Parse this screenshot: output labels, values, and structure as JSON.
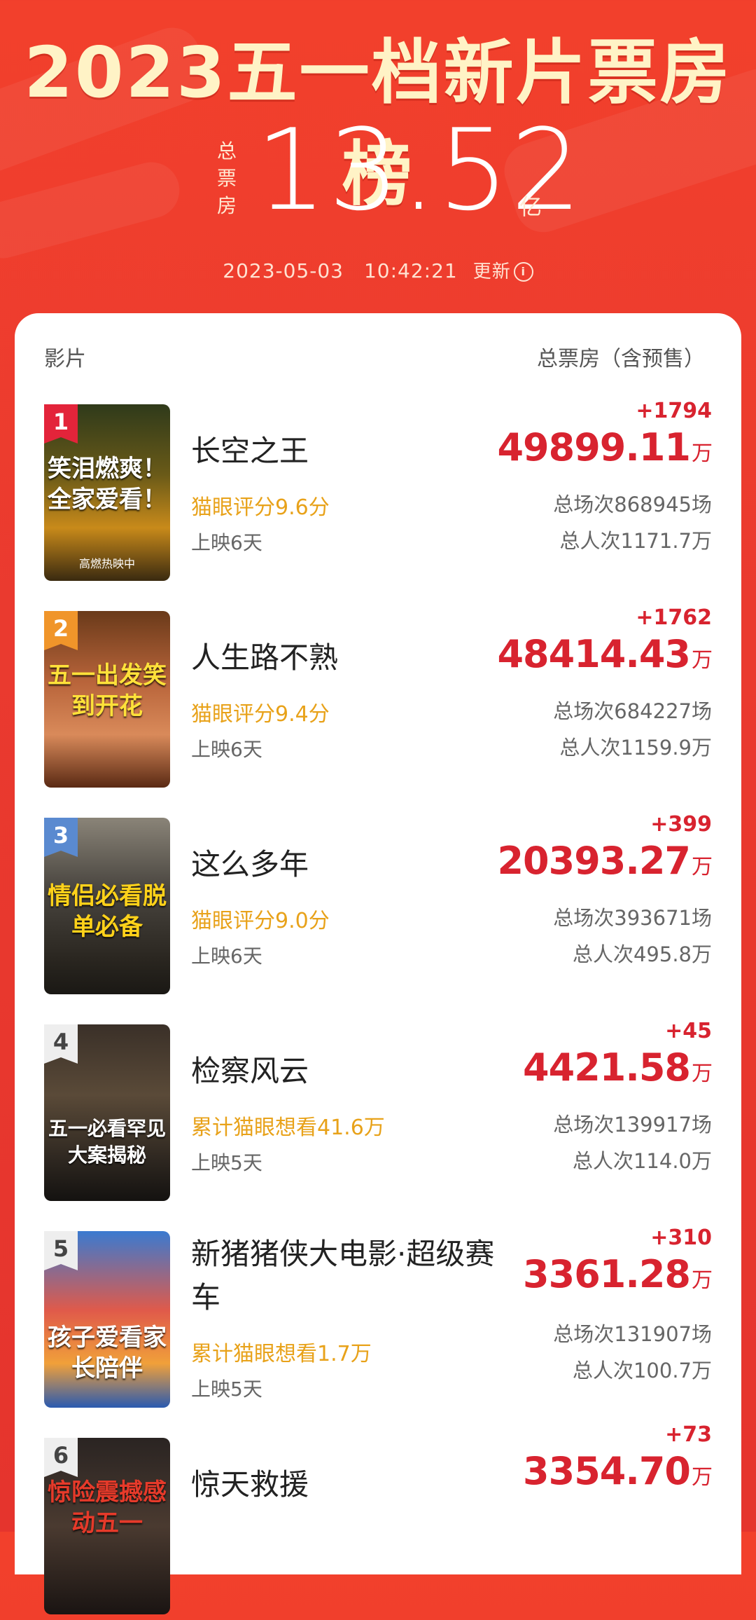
{
  "header": {
    "title": "2023五一档新片票房榜",
    "total_label": "总票房",
    "total_value": "13.52",
    "total_unit": "亿",
    "update_time": "2023-05-03　10:42:21",
    "update_label": "更新",
    "info_icon": "info-icon"
  },
  "table": {
    "col_film": "影片",
    "col_box": "总票房（含预售）"
  },
  "colors": {
    "accent_red": "#d8232f",
    "score_orange": "#e8a21a",
    "bg_red": "#ec3a2e"
  },
  "films": [
    {
      "rank": "1",
      "name": "长空之王",
      "rating": "猫眼评分9.6分",
      "days": "上映6天",
      "delta": "+1794",
      "box": "49899.11",
      "unit": "万",
      "shows": "总场次868945场",
      "viewers": "总人次1171.7万",
      "poster_slogan": "笑泪燃爽！全家爱看！",
      "poster_sub": "高燃热映中"
    },
    {
      "rank": "2",
      "name": "人生路不熟",
      "rating": "猫眼评分9.4分",
      "days": "上映6天",
      "delta": "+1762",
      "box": "48414.43",
      "unit": "万",
      "shows": "总场次684227场",
      "viewers": "总人次1159.9万",
      "poster_slogan": "五一出发笑到开花",
      "poster_sub": ""
    },
    {
      "rank": "3",
      "name": "这么多年",
      "rating": "猫眼评分9.0分",
      "days": "上映6天",
      "delta": "+399",
      "box": "20393.27",
      "unit": "万",
      "shows": "总场次393671场",
      "viewers": "总人次495.8万",
      "poster_slogan": "情侣必看脱单必备",
      "poster_sub": ""
    },
    {
      "rank": "4",
      "name": "检察风云",
      "rating": "累计猫眼想看41.6万",
      "days": "上映5天",
      "delta": "+45",
      "box": "4421.58",
      "unit": "万",
      "shows": "总场次139917场",
      "viewers": "总人次114.0万",
      "poster_slogan": "五一必看罕见大案揭秘",
      "poster_sub": ""
    },
    {
      "rank": "5",
      "name": "新猪猪侠大电影·超级赛车",
      "rating": "累计猫眼想看1.7万",
      "days": "上映5天",
      "delta": "+310",
      "box": "3361.28",
      "unit": "万",
      "shows": "总场次131907场",
      "viewers": "总人次100.7万",
      "poster_slogan": "孩子爱看家长陪伴",
      "poster_sub": ""
    },
    {
      "rank": "6",
      "name": "惊天救援",
      "rating": "",
      "days": "",
      "delta": "+73",
      "box": "3354.70",
      "unit": "万",
      "shows": "",
      "viewers": "",
      "poster_slogan": "惊险震撼感动五一",
      "poster_sub": ""
    }
  ]
}
